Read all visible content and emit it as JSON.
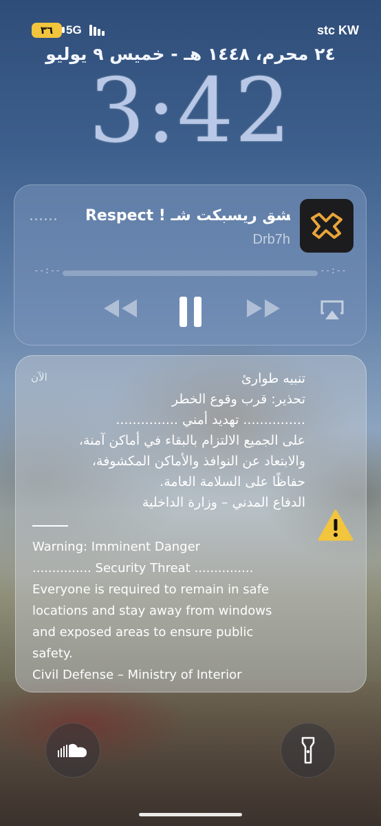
{
  "status_bar": {
    "battery": "٣٦",
    "network": "5G",
    "carrier": "stc KW",
    "battery_color": "#f2c53d"
  },
  "lock_screen": {
    "date": "٢٤ محرم، ١٤٤٨ هـ - خميس ٩ يوليو",
    "time": "3:42"
  },
  "now_playing": {
    "title": "Respect ! بشق ريسبكت شـ",
    "title_fade": "......",
    "artist": "Drb7h",
    "elapsed": "--:--",
    "remaining": "--:--",
    "progress": 0,
    "artwork_icon": "app-logo-icon",
    "controls": [
      "rewind-icon",
      "pause-icon",
      "fast-forward-icon",
      "airplay-icon"
    ]
  },
  "emergency_alert": {
    "timestamp": "الآن",
    "arabic_lines": [
      "تنبيه طوارئ",
      "تحذير: قرب وقوع الخطر",
      "............... تهديد أمني ...............",
      "على الجميع الالتزام بالبقاء في أماكن آمنة،",
      "والابتعاد عن النوافذ والأماكن المكشوفة،",
      "حفاظًا على السلامة العامة.",
      "الدفاع المدني – وزارة الداخلية"
    ],
    "english_lines": [
      "Warning: Imminent Danger",
      "............... Security Threat ...............",
      "Everyone is required to remain in safe",
      "locations and stay away from windows",
      "and exposed areas to ensure public",
      "safety.",
      "Civil Defense – Ministry of Interior"
    ],
    "icon": "warning-icon",
    "icon_color": "#f2c53d"
  },
  "quick_actions": {
    "left": "soundcloud-icon",
    "right": "flashlight-icon"
  }
}
